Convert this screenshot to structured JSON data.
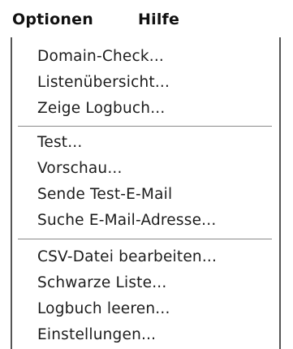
{
  "menubar": {
    "items": [
      {
        "label": "Optionen"
      },
      {
        "label": "Hilfe"
      }
    ]
  },
  "dropdown": {
    "groups": [
      {
        "items": [
          {
            "label": "Domain-Check..."
          },
          {
            "label": "Listenübersicht..."
          },
          {
            "label": "Zeige Logbuch..."
          }
        ]
      },
      {
        "items": [
          {
            "label": "Test..."
          },
          {
            "label": "Vorschau..."
          },
          {
            "label": "Sende Test-E-Mail"
          },
          {
            "label": "Suche E-Mail-Adresse..."
          }
        ]
      },
      {
        "items": [
          {
            "label": "CSV-Datei bearbeiten..."
          },
          {
            "label": "Schwarze Liste..."
          },
          {
            "label": "Logbuch leeren..."
          },
          {
            "label": "Einstellungen..."
          }
        ]
      }
    ]
  }
}
